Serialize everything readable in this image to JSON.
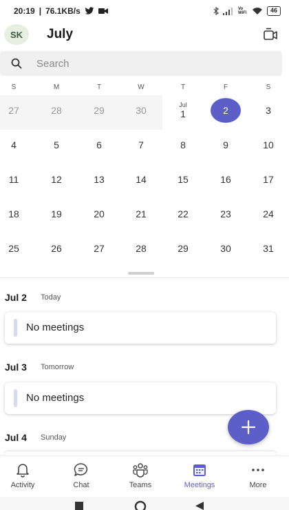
{
  "status_bar": {
    "time": "20:19",
    "speed": "76.1KB/s",
    "network_type": "Vo WiFi",
    "battery": "46"
  },
  "header": {
    "avatar_initials": "SK",
    "month_title": "July"
  },
  "search": {
    "placeholder": "Search"
  },
  "calendar": {
    "weekdays": [
      "S",
      "M",
      "T",
      "W",
      "T",
      "F",
      "S"
    ],
    "weeks": [
      [
        {
          "day": "27",
          "muted": true
        },
        {
          "day": "28",
          "muted": true
        },
        {
          "day": "29",
          "muted": true
        },
        {
          "day": "30",
          "muted": true
        },
        {
          "day": "1",
          "month_label": "Jul"
        },
        {
          "day": "2",
          "selected": true
        },
        {
          "day": "3"
        }
      ],
      [
        {
          "day": "4"
        },
        {
          "day": "5"
        },
        {
          "day": "6"
        },
        {
          "day": "7"
        },
        {
          "day": "8"
        },
        {
          "day": "9"
        },
        {
          "day": "10"
        }
      ],
      [
        {
          "day": "11"
        },
        {
          "day": "12"
        },
        {
          "day": "13"
        },
        {
          "day": "14"
        },
        {
          "day": "15"
        },
        {
          "day": "16"
        },
        {
          "day": "17"
        }
      ],
      [
        {
          "day": "18"
        },
        {
          "day": "19"
        },
        {
          "day": "20"
        },
        {
          "day": "21"
        },
        {
          "day": "22"
        },
        {
          "day": "23"
        },
        {
          "day": "24"
        }
      ],
      [
        {
          "day": "25"
        },
        {
          "day": "26"
        },
        {
          "day": "27"
        },
        {
          "day": "28"
        },
        {
          "day": "29"
        },
        {
          "day": "30"
        },
        {
          "day": "31"
        }
      ]
    ]
  },
  "agenda": [
    {
      "date": "Jul 2",
      "label": "Today",
      "card_text": "No meetings"
    },
    {
      "date": "Jul 3",
      "label": "Tomorrow",
      "card_text": "No meetings"
    },
    {
      "date": "Jul 4",
      "label": "Sunday"
    }
  ],
  "bottom_nav": [
    {
      "label": "Activity",
      "icon": "bell-icon"
    },
    {
      "label": "Chat",
      "icon": "chat-icon"
    },
    {
      "label": "Teams",
      "icon": "teams-icon"
    },
    {
      "label": "Meetings",
      "icon": "calendar-icon",
      "active": true
    },
    {
      "label": "More",
      "icon": "more-icon"
    }
  ],
  "colors": {
    "accent": "#5b5fc7",
    "muted_bg": "#f5f5f5",
    "card_accent": "#d8d8f2"
  }
}
